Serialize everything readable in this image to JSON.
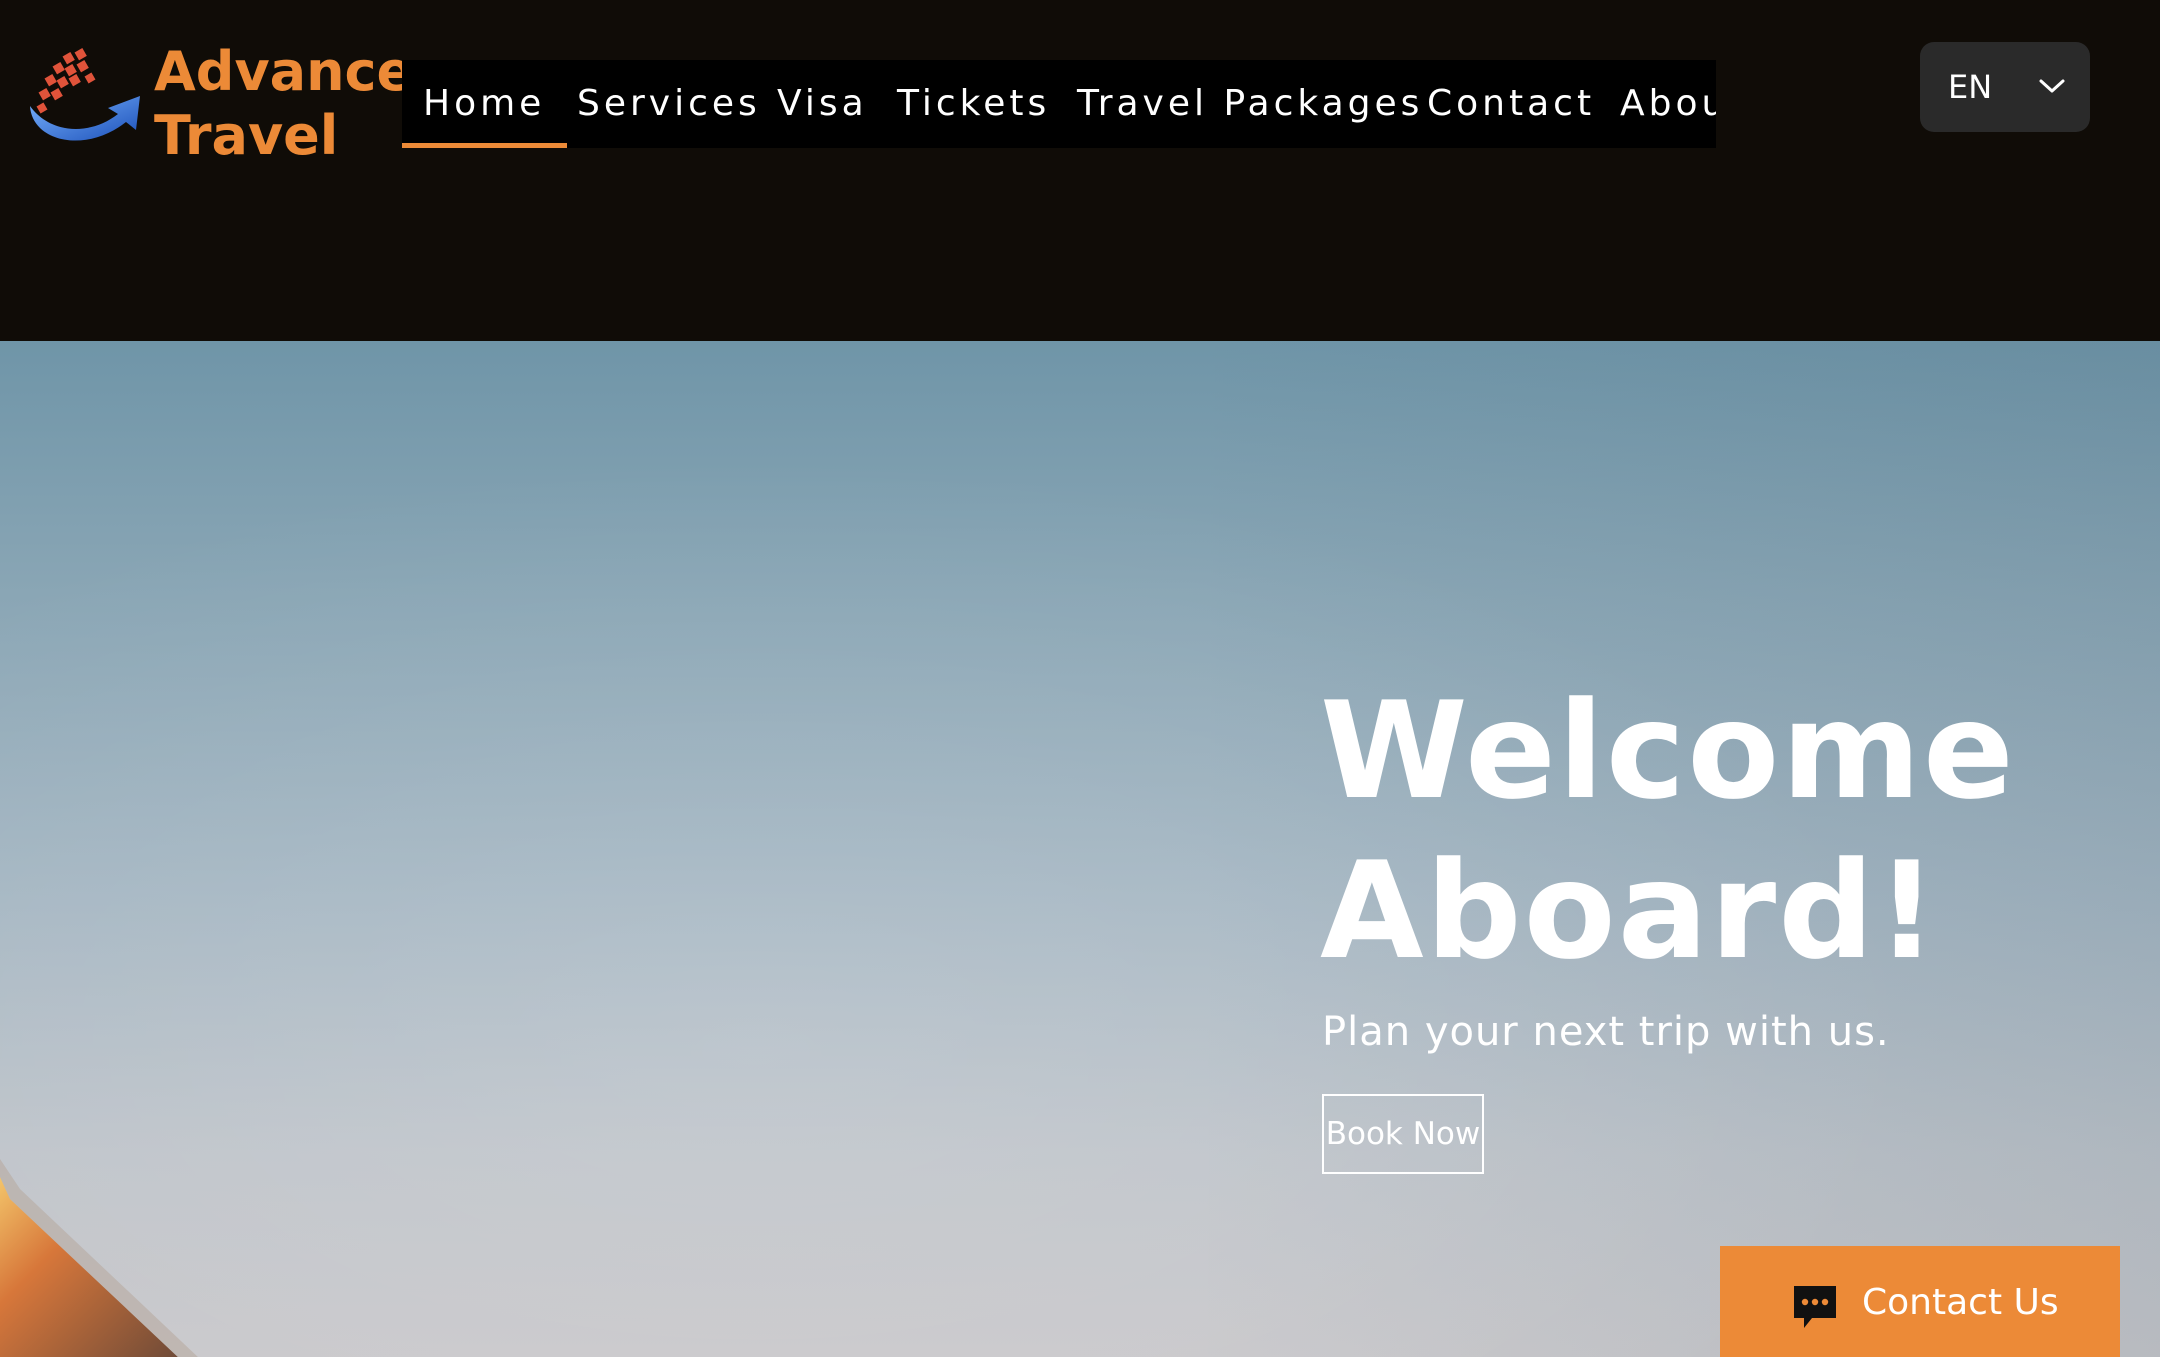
{
  "brand": {
    "line1": "Advance",
    "line2": "Travel",
    "logo_icon": "globe-arrow-logo",
    "color": "#ec8a37"
  },
  "nav": {
    "items": [
      {
        "label": "Home",
        "active": true
      },
      {
        "label": "Services",
        "active": false
      },
      {
        "label": "Visa",
        "active": false
      },
      {
        "label": "Tickets",
        "active": false
      },
      {
        "label": "Travel Packages",
        "active": false
      },
      {
        "label": "Contact",
        "active": false
      },
      {
        "label": "Abou",
        "active": false
      }
    ],
    "accent": "#ec8a37"
  },
  "language": {
    "value": "EN",
    "icon": "chevron-down-icon"
  },
  "hero": {
    "title_line1": "Welcome",
    "title_line2": "Aboard!",
    "subtitle": "Plan your next trip with us.",
    "cta_label": "Book Now"
  },
  "contact_widget": {
    "label": "Contact Us",
    "icon": "chat-bubble-icon",
    "color": "#ec8a37"
  }
}
